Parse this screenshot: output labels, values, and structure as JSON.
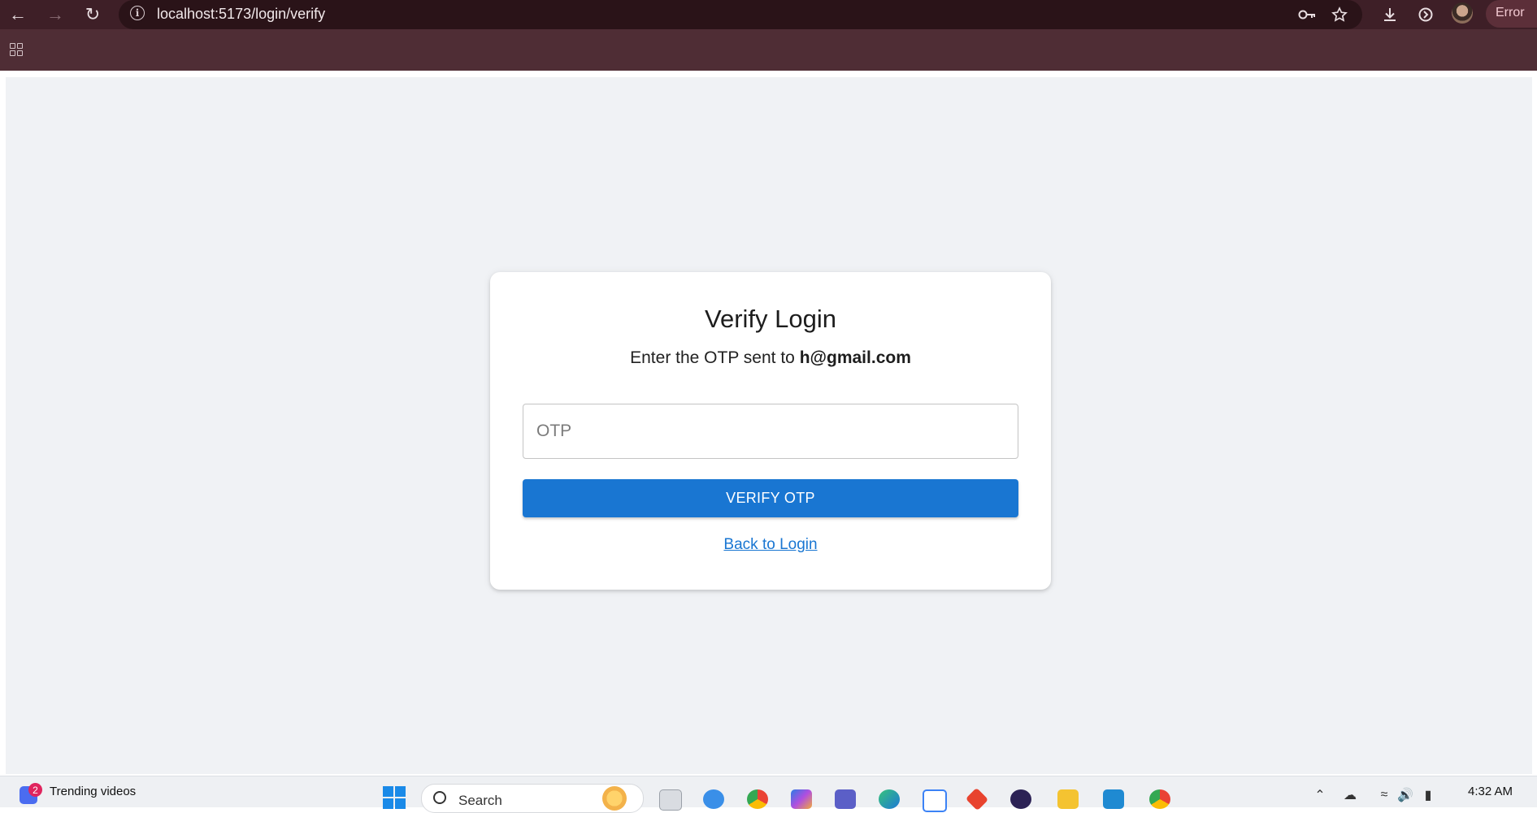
{
  "browser": {
    "url": "localhost:5173/login/verify",
    "profile_status": "Error",
    "icons": {
      "back": "arrow-left-icon",
      "forward": "arrow-right-icon",
      "reload": "reload-icon",
      "site_info": "info-icon",
      "password": "key-icon",
      "bookmark": "star-icon",
      "downloads": "download-icon",
      "extensions": "sync-icon",
      "menu": "kebab-menu-icon",
      "apps": "apps-grid-icon"
    }
  },
  "page": {
    "title": "Verify Login",
    "subtitle_prefix": "Enter the OTP sent to",
    "email": "h@gmail.com",
    "otp_placeholder": "OTP",
    "otp_value": "",
    "verify_button": "VERIFY OTP",
    "back_link": "Back to Login",
    "colors": {
      "primary": "#1976d2",
      "background": "#f0f2f5",
      "card": "#ffffff"
    }
  },
  "taskbar": {
    "widget_badge": "2",
    "widget_text": "Trending videos",
    "search_placeholder": "Search",
    "time": "4:32 AM",
    "apps": [
      "task-view-icon",
      "copilot-icon",
      "chrome-icon",
      "copilot-app-icon",
      "teams-icon",
      "edge-icon",
      "store-icon",
      "git-icon",
      "eclipse-icon",
      "file-explorer-icon",
      "vscode-icon",
      "chrome-profile-icon"
    ]
  }
}
